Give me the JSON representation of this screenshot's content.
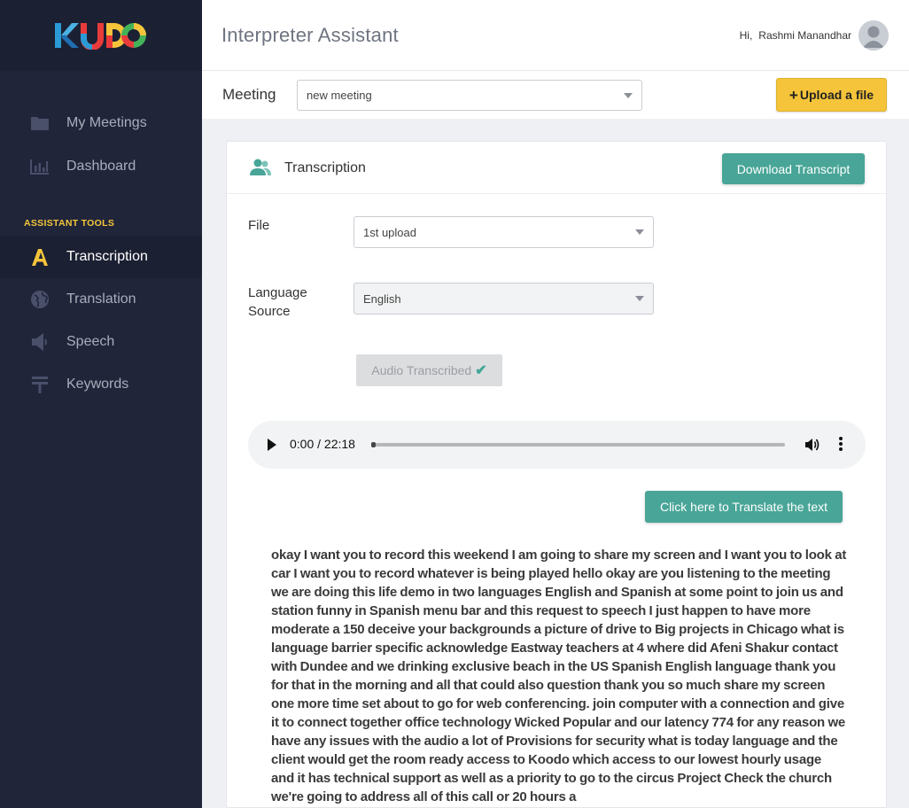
{
  "brand": {
    "logo_text": "KUDO"
  },
  "header": {
    "title": "Interpreter Assistant",
    "greeting": "Hi,",
    "user_name": "Rashmi Manandhar"
  },
  "sidebar": {
    "items": [
      {
        "label": "My Meetings",
        "icon": "folder-icon"
      },
      {
        "label": "Dashboard",
        "icon": "bar-chart-icon"
      }
    ],
    "section_label": "ASSISTANT TOOLS",
    "tools": [
      {
        "label": "Transcription",
        "icon": "font-a-icon",
        "active": true
      },
      {
        "label": "Translation",
        "icon": "globe-icon"
      },
      {
        "label": "Speech",
        "icon": "speaker-icon"
      },
      {
        "label": "Keywords",
        "icon": "text-icon"
      }
    ]
  },
  "meeting_bar": {
    "label": "Meeting",
    "selected": "new meeting",
    "upload_label": "Upload a file"
  },
  "card": {
    "title": "Transcription",
    "download_label": "Download Transcript",
    "file_label": "File",
    "file_selected": "1st upload",
    "language_label": "Language Source",
    "language_selected": "English",
    "transcribed_label": "Audio Transcribed",
    "audio": {
      "current_time": "0:00",
      "duration": "22:18",
      "time_display": "0:00 / 22:18",
      "progress": 0
    },
    "translate_label": "Click here to Translate the text",
    "transcript": "okay I want you to record this weekend I am going to share my screen and I want you to look at car I want you to record whatever is being played hello okay are you listening to the meeting we are doing this life demo in two languages English and Spanish at some point to join us and station funny in Spanish menu bar and this request to speech I just happen to have more moderate a 150 deceive your backgrounds a picture of drive to Big projects in Chicago what is language barrier specific acknowledge Eastway teachers at 4 where did Afeni Shakur contact with Dundee and we drinking exclusive beach in the US Spanish English language thank you for that in the morning and all that could also question thank you so much share my screen one more time set about to go for web conferencing. join computer with a connection and give it to connect together office technology Wicked Popular and our latency 774 for any reason we have any issues with the audio a lot of Provisions for security what is today language and the client would get the room ready access to Koodo which access to our lowest hourly usage and it has technical support as well as a priority to go to the circus Project Check the church we're going to address all of this call or 20 hours a"
  },
  "colors": {
    "sidebar_bg": "#20253a",
    "accent_yellow": "#f5c43a",
    "accent_teal": "#48a597"
  }
}
